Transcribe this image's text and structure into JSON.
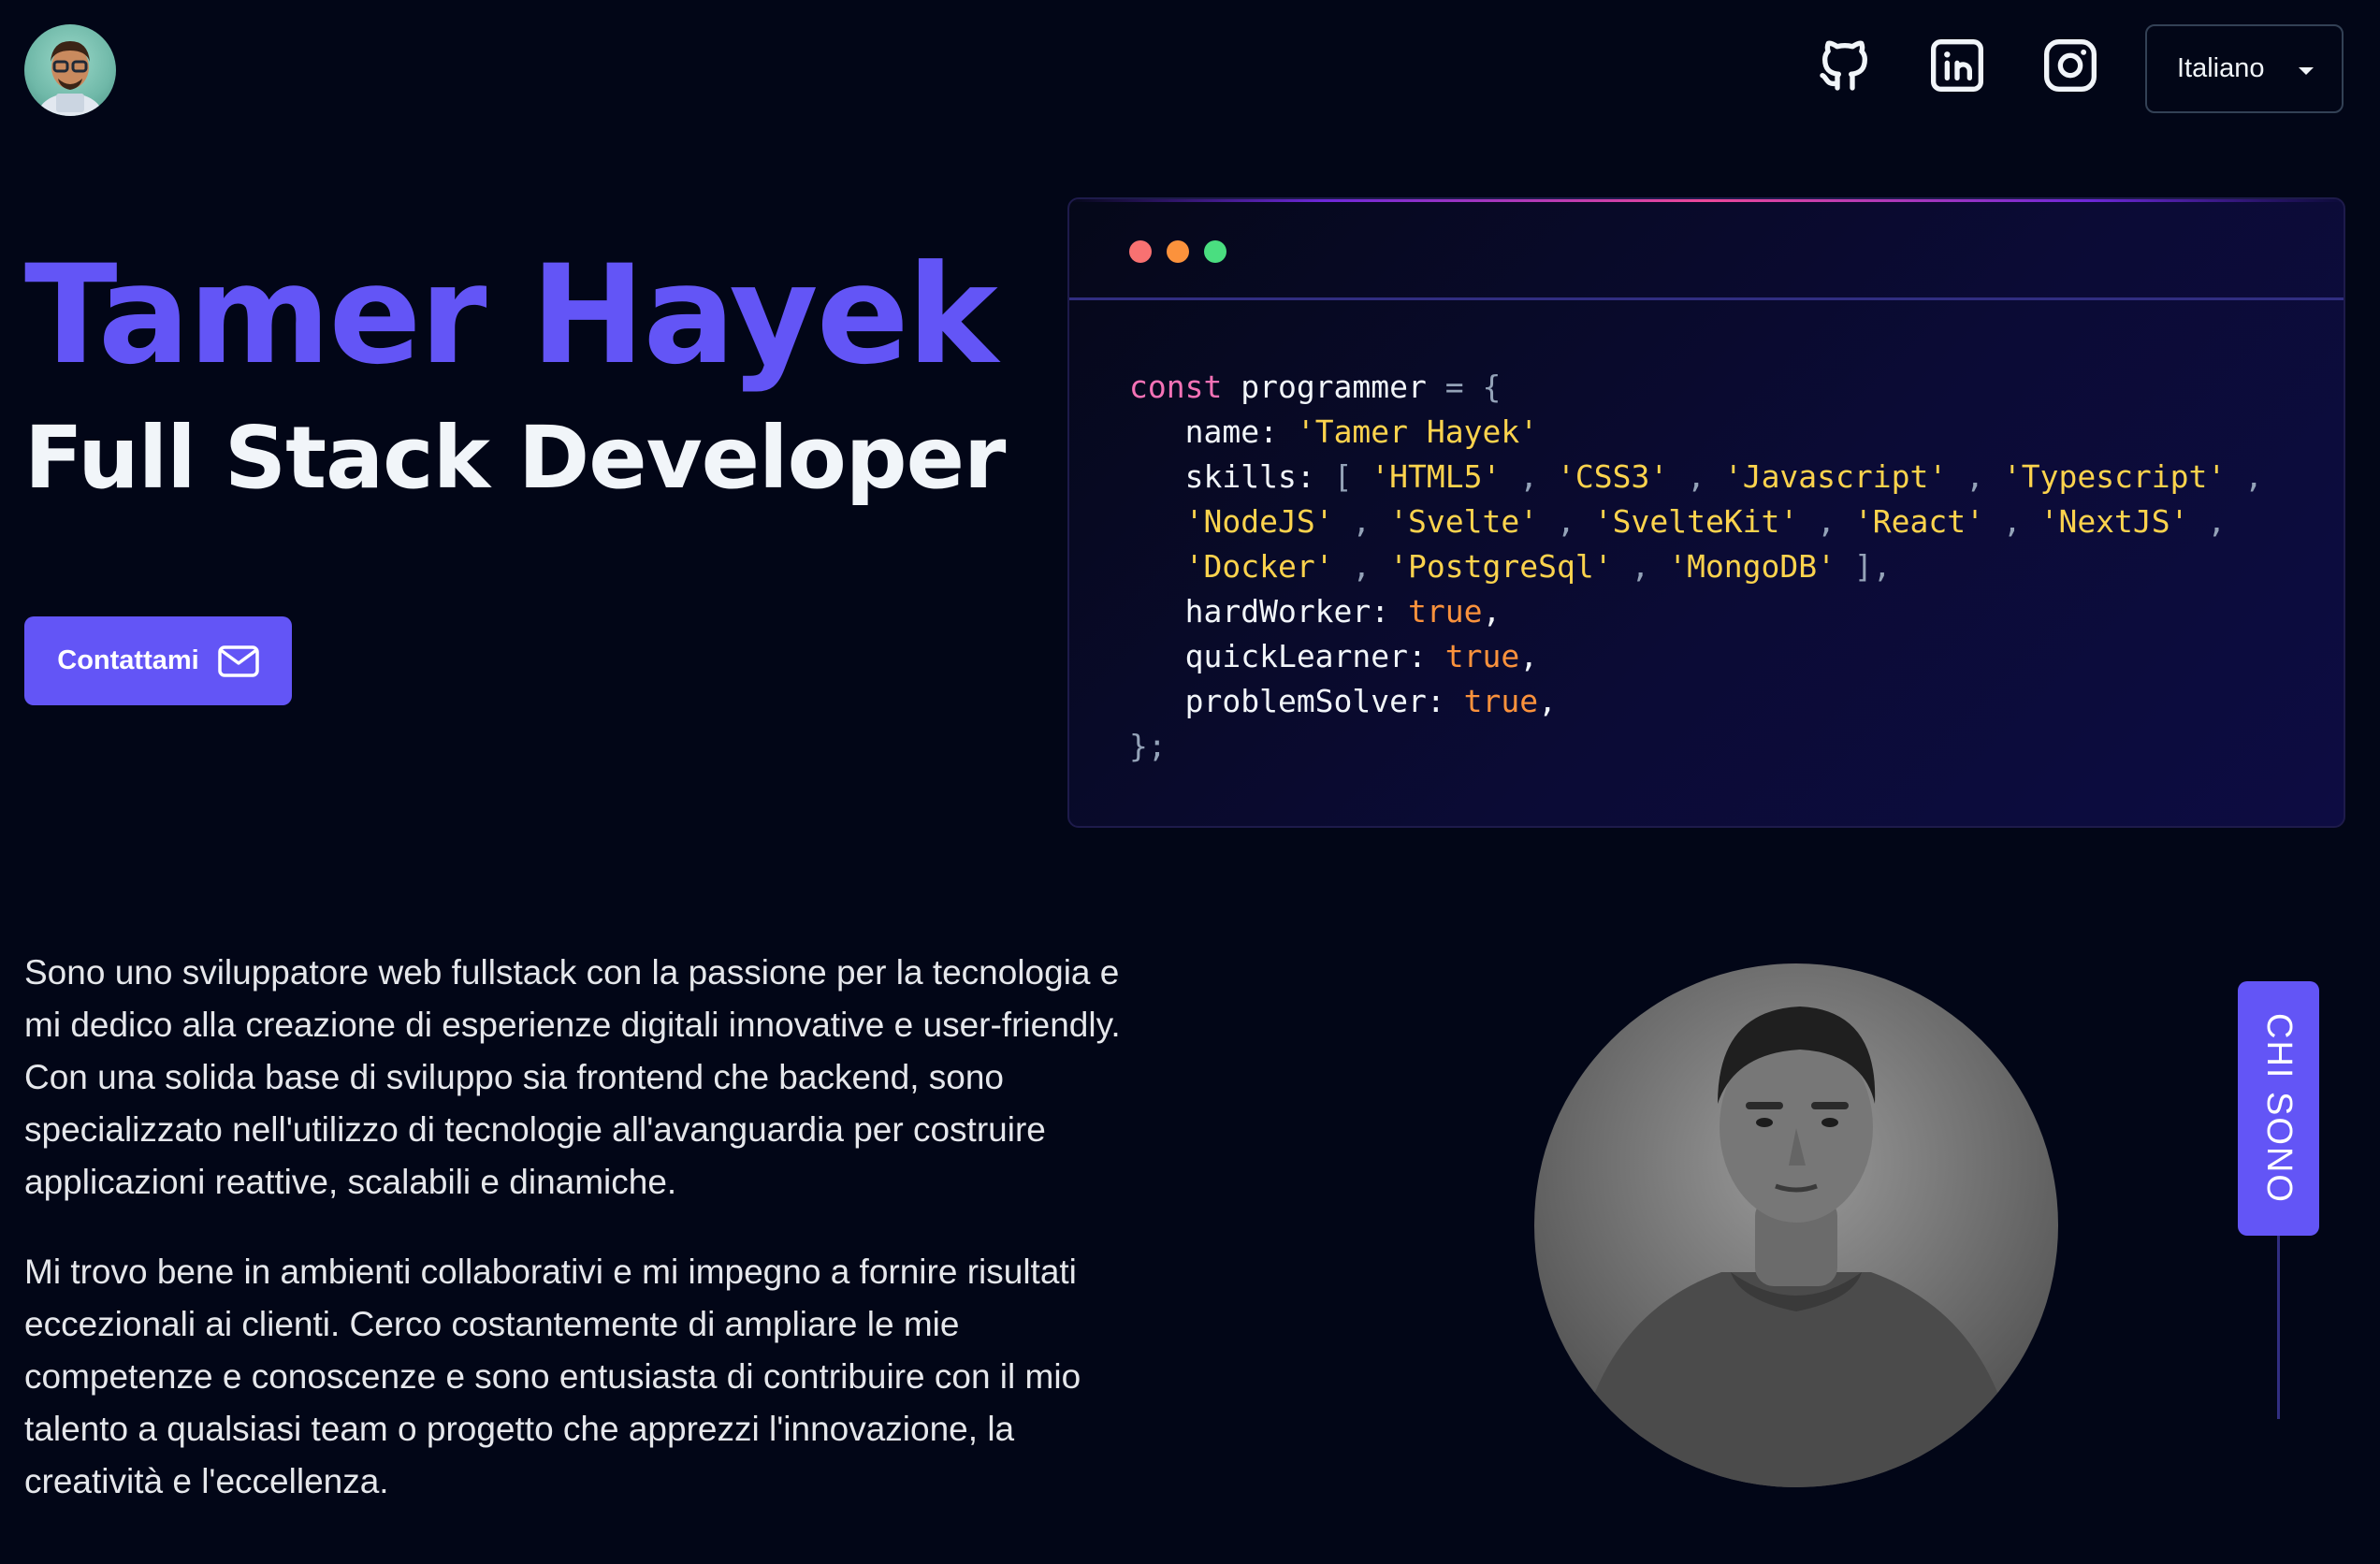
{
  "header": {
    "avatar_icon": "memoji-avatar-icon",
    "social": [
      {
        "icon": "github-icon"
      },
      {
        "icon": "linkedin-icon"
      },
      {
        "icon": "instagram-icon"
      }
    ],
    "language_select": {
      "value": "Italiano",
      "icon": "caret-down-icon"
    }
  },
  "hero": {
    "name": "Tamer Hayek",
    "role": "Full Stack Developer",
    "cta_label": "Contattami",
    "cta_icon": "mail-icon"
  },
  "code_window": {
    "window_dots": [
      "#f87171",
      "#fb923c",
      "#4ade80"
    ],
    "lines": [
      {
        "kw": "const",
        "ident": " programmer ",
        "op": "= {"
      },
      {
        "key": "name: ",
        "values": [
          "'Tamer Hayek'"
        ]
      },
      {
        "key": "skills: ",
        "values": [
          "'HTML5'",
          "'CSS3'",
          "'Javascript'",
          "'Typescript'"
        ]
      },
      {
        "values": [
          "'NodeJS'",
          "'Svelte'",
          "'SvelteKit'",
          "'React'",
          "'NextJS'"
        ]
      },
      {
        "values": [
          "'Docker'",
          "'PostgreSql'",
          "'MongoDB'"
        ]
      },
      {
        "key": "hardWorker: ",
        "bool": "true"
      },
      {
        "key": "quickLearner: ",
        "bool": "true"
      },
      {
        "key": "problemSolver: ",
        "bool": "true"
      },
      {
        "close": "};"
      }
    ]
  },
  "about": {
    "paragraphs": [
      "Sono uno sviluppatore web fullstack con la passione per la tecnologia e mi dedico alla creazione di esperienze digitali innovative e user-friendly. Con una solida base di sviluppo sia frontend che backend, sono specializzato nell'utilizzo di tecnologie all'avanguardia per costruire applicazioni reattive, scalabili e dinamiche.",
      "Mi trovo bene in ambienti collaborativi e mi impegno a fornire risultati eccezionali ai clienti. Cerco costantemente di ampliare le mie competenze e conoscenze e sono entusiasta di contribuire con il mio talento a qualsiasi team o progetto che apprezzi l'innovazione, la creatività e l'eccellenza."
    ],
    "portrait_icon": "portrait-photo",
    "side_tab_label": "CHI SONO"
  },
  "colors": {
    "background": "#020617",
    "accent": "#6355f6",
    "keyword": "#f472b6",
    "string": "#fcd34d",
    "boolean": "#fb923c"
  }
}
